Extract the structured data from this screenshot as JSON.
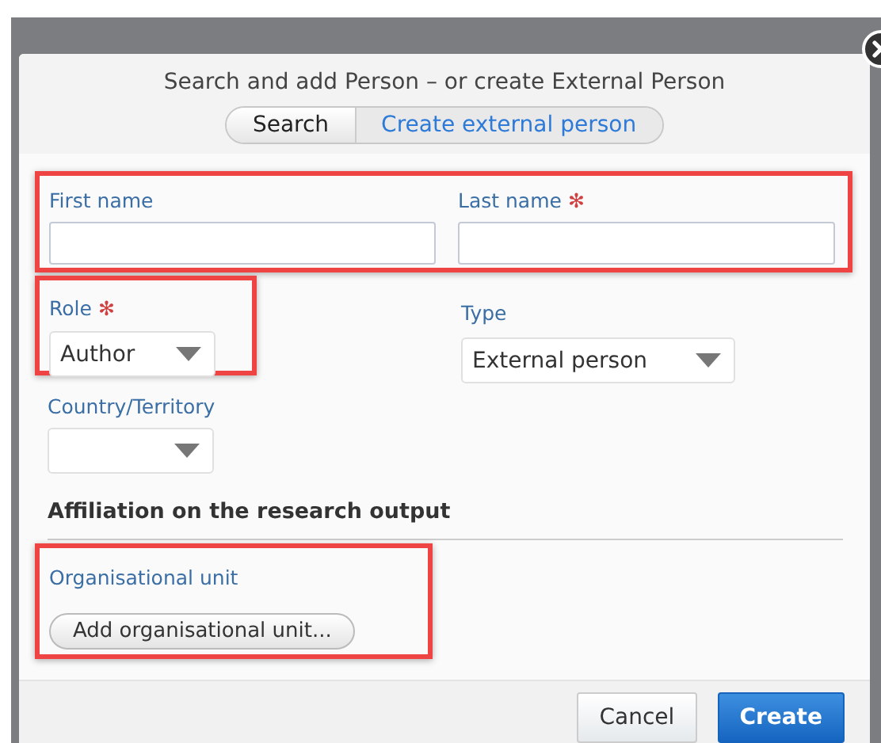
{
  "dialog": {
    "title": "Search and add Person – or create External Person"
  },
  "tabs": [
    {
      "label": "Search",
      "selected": false
    },
    {
      "label": "Create external person",
      "selected": true
    }
  ],
  "fields": {
    "first_name": {
      "label": "First name"
    },
    "last_name": {
      "label": "Last name",
      "required_mark": "✻"
    },
    "role": {
      "label": "Role",
      "required_mark": "✻",
      "value": "Author"
    },
    "type": {
      "label": "Type",
      "value": "External person"
    },
    "country": {
      "label": "Country/Territory"
    }
  },
  "affiliation": {
    "heading": "Affiliation on the research output",
    "label": "Organisational unit",
    "button": "Add organisational unit..."
  },
  "buttons": [
    {
      "label": "Cancel",
      "kind": "secondary"
    },
    {
      "label": "Create",
      "kind": "primary"
    }
  ]
}
